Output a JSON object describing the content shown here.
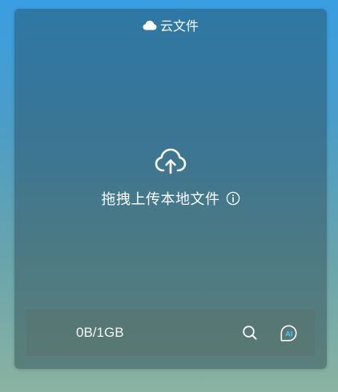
{
  "header": {
    "title": "云文件",
    "icon": "cloud-icon"
  },
  "drop_zone": {
    "icon": "cloud-upload-icon",
    "text": "拖拽上传本地文件",
    "info_icon": "info-icon"
  },
  "footer": {
    "storage": "0B/1GB",
    "search_icon": "search-icon",
    "ai_label": "AI",
    "ai_icon": "ai-assistant-icon"
  },
  "colors": {
    "panel_top": "#2e78a6",
    "panel_bottom": "#5b7f7a",
    "text": "#ffffff",
    "ai_accent": "#4fc3f7"
  }
}
